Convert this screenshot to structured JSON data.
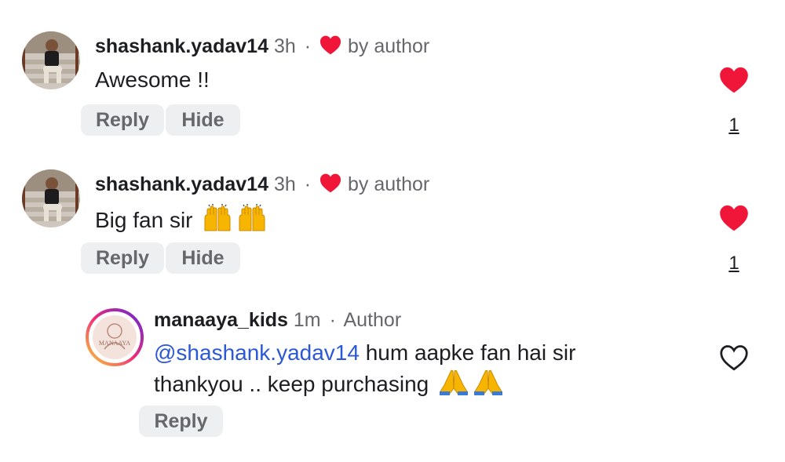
{
  "colors": {
    "heart_red": "#f0163a",
    "mention_blue": "#2b59d6",
    "pill_bg": "#eeeff1",
    "muted_text": "#65676b",
    "story_ring": [
      "#f9ce34",
      "#ee2a7b",
      "#6228d7"
    ]
  },
  "comments": [
    {
      "username": "shashank.yadav14",
      "time": "3h",
      "separator": "·",
      "author_like_icon": "heart-filled-icon",
      "author_like_label": "by author",
      "text": "Awesome !!",
      "reply_label": "Reply",
      "hide_label": "Hide",
      "like_icon": "heart-filled-icon",
      "like_count": "1"
    },
    {
      "username": "shashank.yadav14",
      "time": "3h",
      "separator": "·",
      "author_like_icon": "heart-filled-icon",
      "author_like_label": "by author",
      "text": "Big fan sir",
      "emojis": [
        "raising-hands-icon",
        "raising-hands-icon"
      ],
      "reply_label": "Reply",
      "hide_label": "Hide",
      "like_icon": "heart-filled-icon",
      "like_count": "1"
    }
  ],
  "reply": {
    "username": "manaaya_kids",
    "time": "1m",
    "separator": "·",
    "author_badge": "Author",
    "avatar_text": "MANAAYA",
    "mention": "@shashank.yadav14",
    "text_line1": " hum aapke fan hai sir",
    "text_line2": "thankyou .. keep purchasing",
    "emojis": [
      "folded-hands-icon",
      "folded-hands-icon"
    ],
    "reply_label": "Reply",
    "like_icon": "heart-outline-icon"
  }
}
